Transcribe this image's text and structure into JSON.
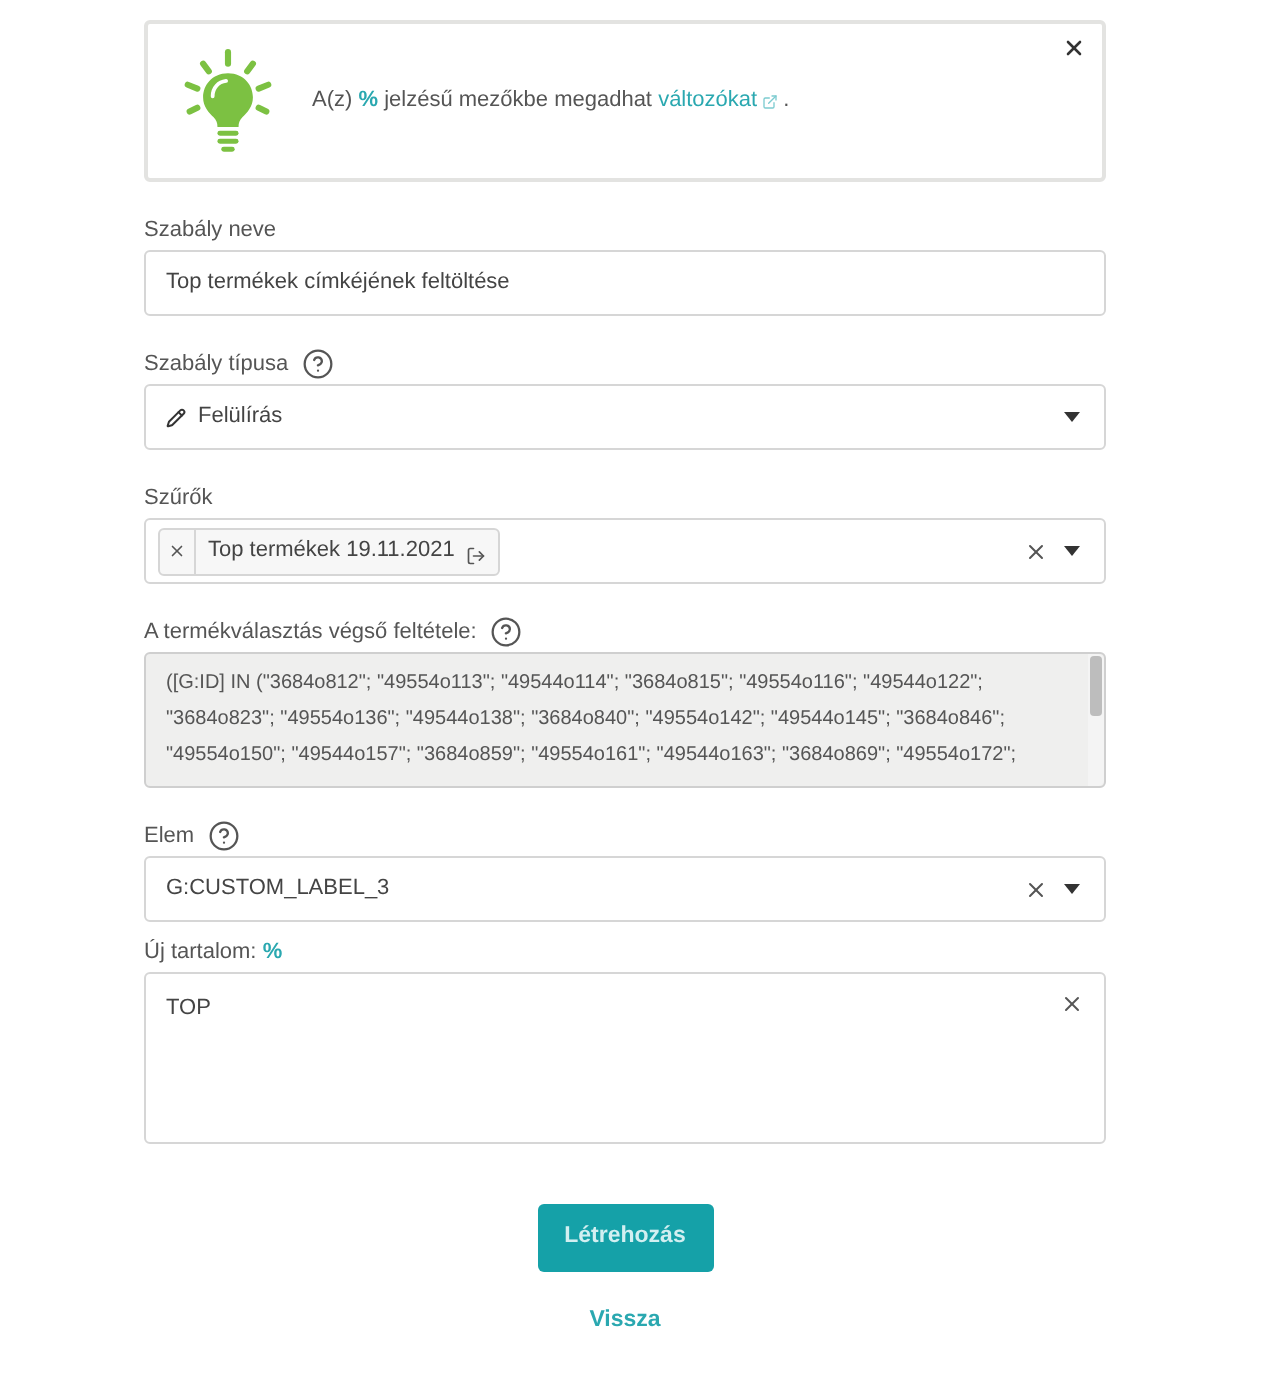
{
  "notice": {
    "text_before": "A(z)",
    "symbol": "%",
    "text_middle": "jelzésű mezőkbe megadhat",
    "link": "változókat",
    "text_after": "."
  },
  "fields": [
    {
      "kind": "text",
      "label": "Szabály neve",
      "value": "Top termékek címkéjének feltöltése"
    },
    {
      "kind": "select",
      "label": "Szabály típusa",
      "help": true,
      "icon": true,
      "value": "Felülírás"
    },
    {
      "kind": "tags",
      "label": "Szűrők",
      "tags": [
        "Top termékek 19.11.2021"
      ],
      "clearable": true
    },
    {
      "kind": "textarea",
      "label": "A termékválasztás végső feltétele:",
      "help": true,
      "disabled": true,
      "value": "([G:ID] IN (\"3684o812\"; \"49554o113\"; \"49544o114\"; \"3684o815\"; \"49554o116\"; \"49544o122\"; \"3684o823\"; \"49554o136\"; \"49544o138\"; \"3684o840\"; \"49554o142\"; \"49544o145\"; \"3684o846\"; \"49554o150\"; \"49544o157\"; \"3684o859\"; \"49554o161\"; \"49544o163\"; \"3684o869\"; \"49554o172\";"
    },
    {
      "kind": "select",
      "label": "Elem",
      "help": true,
      "value": "G:CUSTOM_LABEL_3",
      "clearable": true
    },
    {
      "kind": "textarea",
      "label": "Új tartalom:",
      "symbol": "%",
      "disabled": false,
      "value": "TOP",
      "clearable": true
    }
  ],
  "buttons": {
    "submit": "Létrehozás",
    "back": "Vissza"
  }
}
